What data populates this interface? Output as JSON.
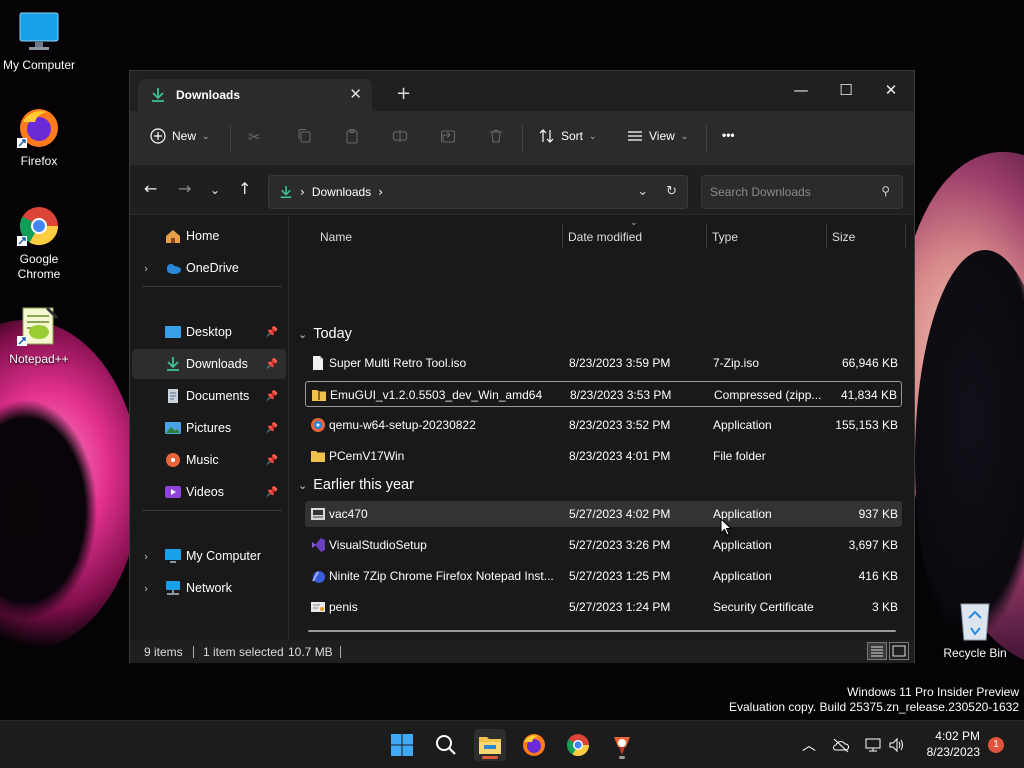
{
  "desktop": {
    "icons": [
      {
        "label": "My Computer"
      },
      {
        "label": "Firefox"
      },
      {
        "label": "Google Chrome"
      },
      {
        "label": "Notepad++"
      },
      {
        "label": "Recycle Bin"
      }
    ],
    "watermark_line1": "Windows 11 Pro Insider Preview",
    "watermark_line2": "Evaluation copy. Build 25375.zn_release.230520-1632"
  },
  "window": {
    "tab_title": "Downloads",
    "tab_close": "✕",
    "new_tab": "+",
    "minimize": "—",
    "maximize": "☐",
    "close": "✕"
  },
  "toolbar": {
    "new_label": "New",
    "sort_label": "Sort",
    "view_label": "View",
    "more_label": "•••"
  },
  "address": {
    "crumb": "Downloads",
    "search_placeholder": "Search Downloads"
  },
  "sidebar": {
    "items": [
      {
        "label": "Home"
      },
      {
        "label": "OneDrive"
      },
      {
        "label": "Desktop"
      },
      {
        "label": "Downloads"
      },
      {
        "label": "Documents"
      },
      {
        "label": "Pictures"
      },
      {
        "label": "Music"
      },
      {
        "label": "Videos"
      },
      {
        "label": "My Computer"
      },
      {
        "label": "Network"
      }
    ]
  },
  "filelist": {
    "columns": {
      "name": "Name",
      "date": "Date modified",
      "type": "Type",
      "size": "Size"
    },
    "groups": [
      {
        "label": "Today",
        "rows": [
          {
            "name": "Super Multi Retro Tool.iso",
            "date": "8/23/2023 3:59 PM",
            "type": "7-Zip.iso",
            "size": "66,946 KB"
          },
          {
            "name": "EmuGUI_v1.2.0.5503_dev_Win_amd64",
            "date": "8/23/2023 3:53 PM",
            "type": "Compressed (zipp...",
            "size": "41,834 KB"
          },
          {
            "name": "qemu-w64-setup-20230822",
            "date": "8/23/2023 3:52 PM",
            "type": "Application",
            "size": "155,153 KB"
          },
          {
            "name": "PCemV17Win",
            "date": "8/23/2023 4:01 PM",
            "type": "File folder",
            "size": ""
          }
        ]
      },
      {
        "label": "Earlier this year",
        "rows": [
          {
            "name": "vac470",
            "date": "5/27/2023 4:02 PM",
            "type": "Application",
            "size": "937 KB"
          },
          {
            "name": "VisualStudioSetup",
            "date": "5/27/2023 3:26 PM",
            "type": "Application",
            "size": "3,697 KB"
          },
          {
            "name": "Ninite 7Zip Chrome Firefox Notepad Inst...",
            "date": "5/27/2023 1:25 PM",
            "type": "Application",
            "size": "416 KB"
          },
          {
            "name": "penis",
            "date": "5/27/2023 1:24 PM",
            "type": "Security Certificate",
            "size": "3 KB"
          }
        ]
      }
    ]
  },
  "status": {
    "items_count": "9 items",
    "selection": "1 item selected",
    "selection_size": "10.7 MB"
  },
  "taskbar": {
    "time": "4:02 PM",
    "date": "8/23/2023",
    "notification_count": "1"
  }
}
